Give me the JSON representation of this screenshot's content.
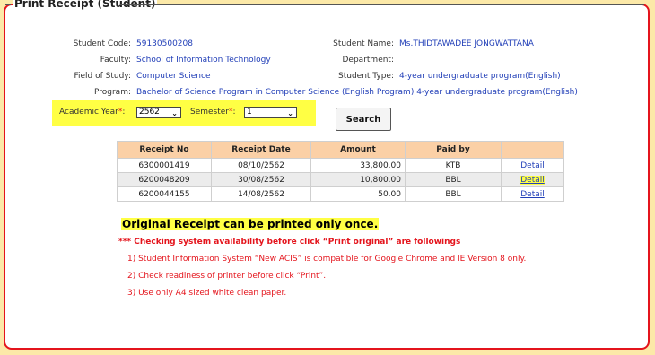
{
  "section_title": "Print Receipt (Student)",
  "student": {
    "code_label": "Student Code:",
    "code": "59130500208",
    "name_label": "Student Name:",
    "name": "Ms.THIDTAWADEE JONGWATTANA",
    "faculty_label": "Faculty:",
    "faculty": "School of Information Technology",
    "department_label": "Department:",
    "department": "",
    "field_label": "Field of Study:",
    "field": "Computer Science",
    "type_label": "Student Type:",
    "type": "4-year undergraduate program(English)",
    "program_label": "Program:",
    "program": "Bachelor of Science Program in Computer Science (English Program) 4-year undergraduate program(English)"
  },
  "filters": {
    "year_label": "Academic Year",
    "year_value": "2562",
    "semester_label": "Semester",
    "semester_value": "1",
    "required_mark": "*",
    "colon": ":",
    "search_label": "Search"
  },
  "table": {
    "headers": [
      "Receipt No",
      "Receipt Date",
      "Amount",
      "Paid by",
      ""
    ],
    "rows": [
      {
        "no": "6300001419",
        "date": "08/10/2562",
        "amount": "33,800.00",
        "paid_by": "KTB",
        "action": "Detail"
      },
      {
        "no": "6200048209",
        "date": "30/08/2562",
        "amount": "10,800.00",
        "paid_by": "BBL",
        "action": "Detail"
      },
      {
        "no": "6200044155",
        "date": "14/08/2562",
        "amount": "50.00",
        "paid_by": "BBL",
        "action": "Detail"
      }
    ]
  },
  "notice": {
    "once": "Original Receipt can be printed only once.",
    "checking": "*** Checking system availability before click “Print original” are followings",
    "item1": "1) Student Information System “New ACIS” is compatible for Google Chrome and IE Version 8 only.",
    "item2": "2) Check readiness of printer before click “Print”.",
    "item3": "3) Use only A4 sized white clean paper."
  },
  "colors": {
    "frame_border": "#e4141c",
    "background": "#fce9a8",
    "highlight": "#ffff44",
    "table_header": "#fbd0a6",
    "link": "#2340b8"
  }
}
